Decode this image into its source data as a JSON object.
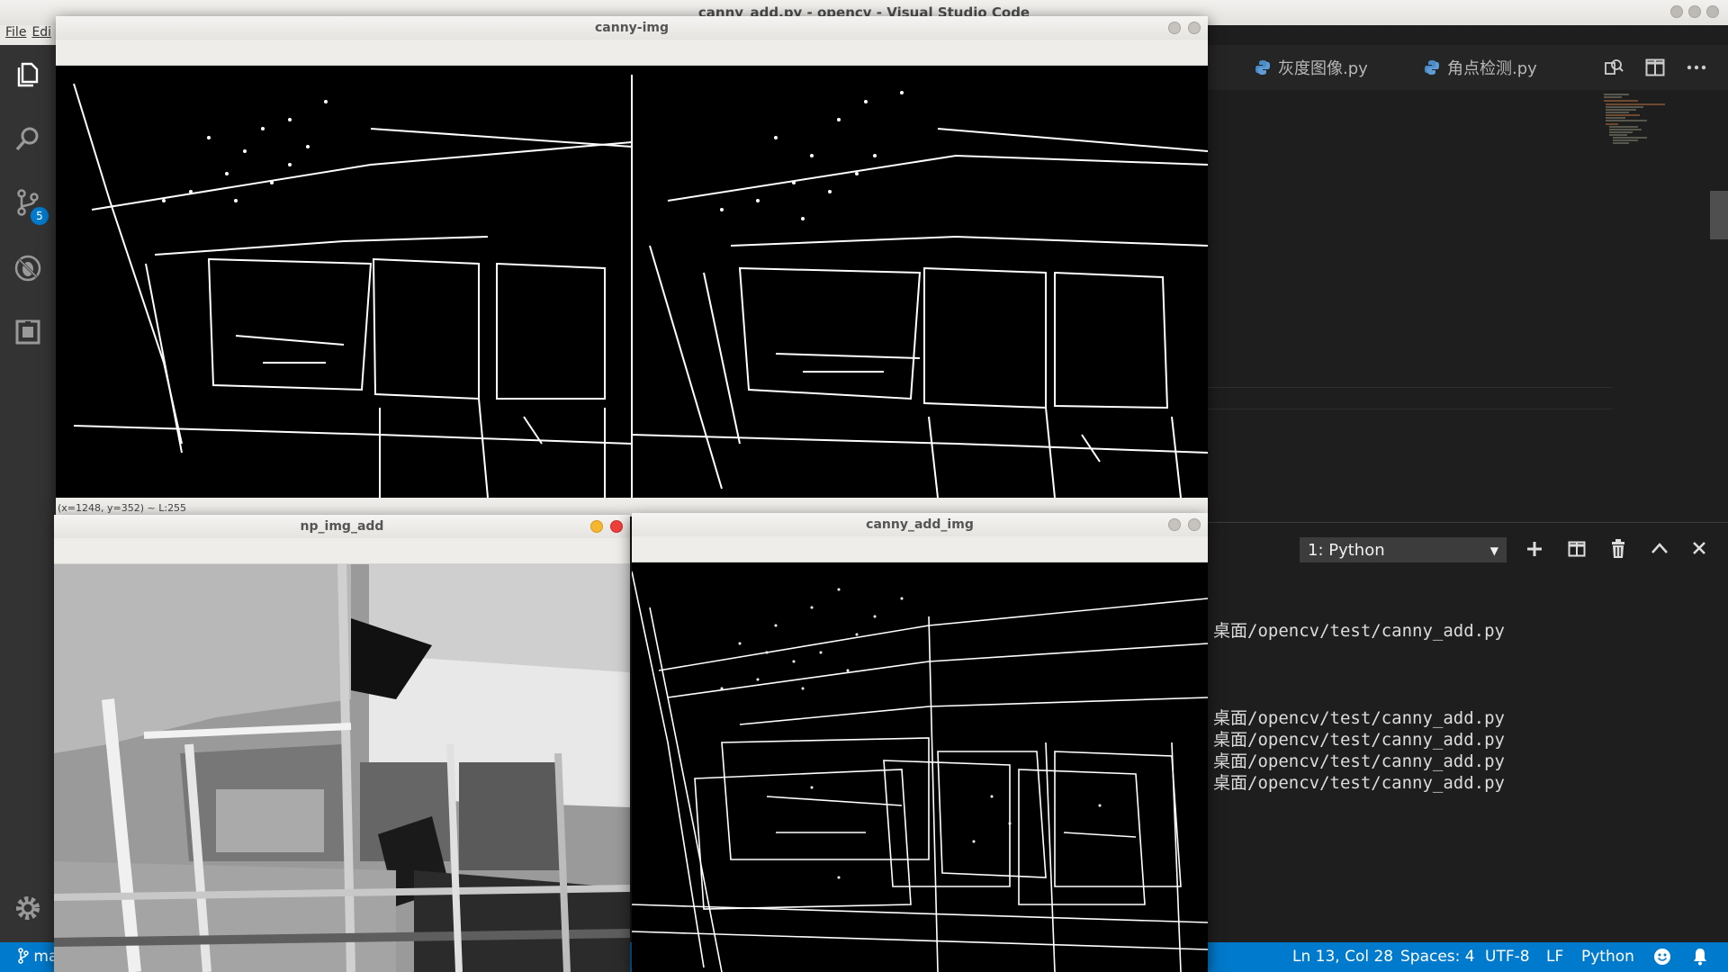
{
  "system": {
    "window_title": "canny_add.py - opencv - Visual Studio Code"
  },
  "menu": {
    "file": "File",
    "edit": "Edi"
  },
  "activity_bar": {
    "scm_badge": "5"
  },
  "editor_tabs": [
    {
      "label": "灰度图像.py"
    },
    {
      "label": "角点检测.py"
    }
  ],
  "terminal": {
    "selector_value": "1: Python",
    "lines": [
      "桌面/opencv/test/canny_add.py",
      "桌面/opencv/test/canny_add.py",
      "桌面/opencv/test/canny_add.py",
      "桌面/opencv/test/canny_add.py",
      "桌面/opencv/test/canny_add.py"
    ]
  },
  "statusbar": {
    "branch": "ma",
    "position": "Ln 13, Col 28",
    "spaces": "Spaces: 4",
    "encoding": "UTF-8",
    "eol": "LF",
    "language": "Python"
  },
  "windows": {
    "canny_img": {
      "title": "canny-img",
      "status": "(x=1248, y=352) ~ L:255"
    },
    "np_img_add": {
      "title": "np_img_add"
    },
    "canny_add_img": {
      "title": "canny_add_img"
    }
  },
  "colors": {
    "statusbar": "#007acc",
    "activity_bar": "#333333",
    "editor_bg": "#1e1e1e",
    "close_red": "#f0403c",
    "minimize_orange": "#f5b631"
  },
  "icons": [
    "explorer-icon",
    "search-icon",
    "source-control-icon",
    "debug-icon",
    "extensions-icon",
    "gear-icon",
    "python-file-icon",
    "open-changes-icon",
    "split-editor-icon",
    "more-icon",
    "add-terminal-icon",
    "split-terminal-icon",
    "trash-icon",
    "chevron-up-icon",
    "close-icon",
    "git-branch-icon",
    "smiley-icon",
    "bell-icon"
  ]
}
